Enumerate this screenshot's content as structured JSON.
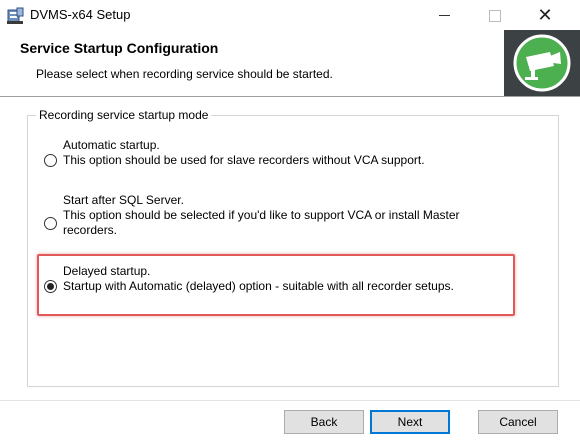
{
  "window": {
    "title": "DVMS-x64 Setup",
    "minimize_glyph": "—",
    "maximize_glyph": "☐",
    "close_glyph": "✕"
  },
  "header": {
    "title": "Service Startup Configuration",
    "subtitle": "Please select when recording service should be started.",
    "logo_icon": "camera-icon",
    "logo_color": "#4caf50"
  },
  "group": {
    "legend": "Recording service startup mode",
    "options": [
      {
        "title": "Automatic startup.",
        "description": "This option should be used for slave recorders without VCA support.",
        "selected": false
      },
      {
        "title": "Start after SQL Server.",
        "description": "This option should be selected if you'd like to support VCA or install Master recorders.",
        "selected": false
      },
      {
        "title": "Delayed startup.",
        "description": "Startup with Automatic (delayed) option - suitable with all recorder setups.",
        "selected": true
      }
    ]
  },
  "buttons": {
    "back": "Back",
    "next": "Next",
    "cancel": "Cancel"
  }
}
